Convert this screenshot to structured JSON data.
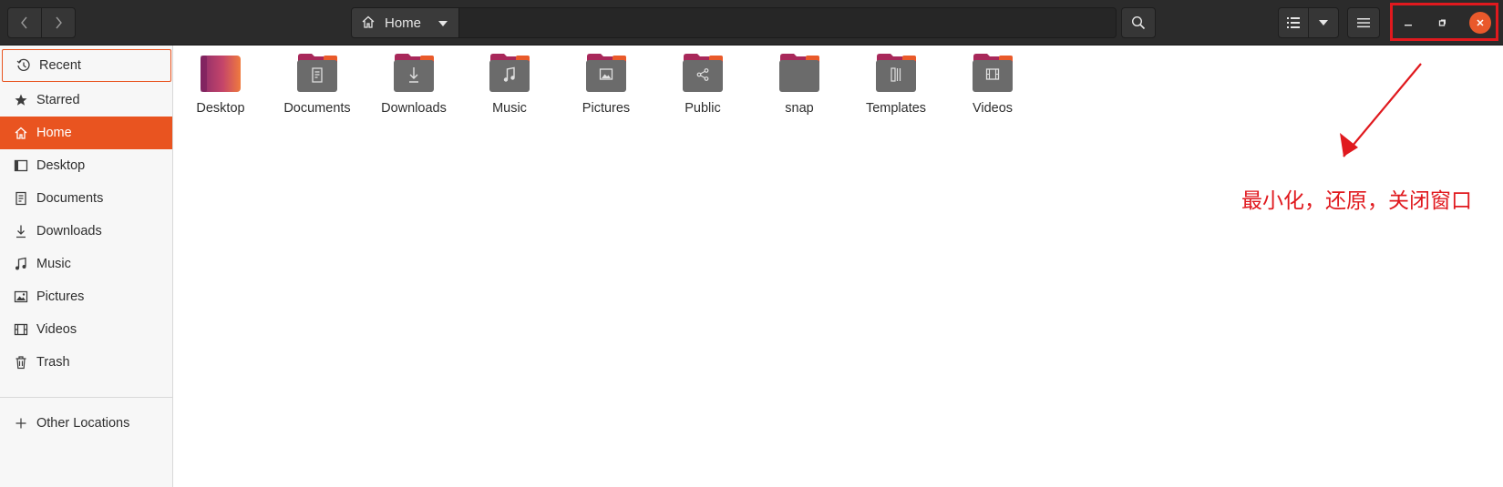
{
  "header": {
    "path_label": "Home",
    "icons": {
      "back": "chevron-left-icon",
      "forward": "chevron-right-icon",
      "home": "home-icon",
      "path_dropdown": "caret-down-icon",
      "search": "search-icon",
      "view_list": "list-view-icon",
      "view_options": "caret-down-icon",
      "menu": "hamburger-menu-icon",
      "minimize": "minimize-icon",
      "restore": "restore-icon",
      "close": "close-icon"
    }
  },
  "sidebar": {
    "items": [
      {
        "label": "Recent",
        "icon": "clock-icon",
        "state": "focused"
      },
      {
        "label": "Starred",
        "icon": "star-icon"
      },
      {
        "label": "Home",
        "icon": "home-icon",
        "state": "active"
      },
      {
        "label": "Desktop",
        "icon": "desktop-icon"
      },
      {
        "label": "Documents",
        "icon": "document-icon"
      },
      {
        "label": "Downloads",
        "icon": "download-icon"
      },
      {
        "label": "Music",
        "icon": "music-icon"
      },
      {
        "label": "Pictures",
        "icon": "picture-icon"
      },
      {
        "label": "Videos",
        "icon": "video-icon"
      },
      {
        "label": "Trash",
        "icon": "trash-icon"
      }
    ],
    "other_locations": {
      "label": "Other Locations",
      "icon": "plus-icon"
    }
  },
  "folders": [
    {
      "label": "Desktop",
      "icon": "desktop-folder-icon"
    },
    {
      "label": "Documents",
      "icon": "documents-folder-icon"
    },
    {
      "label": "Downloads",
      "icon": "downloads-folder-icon"
    },
    {
      "label": "Music",
      "icon": "music-folder-icon"
    },
    {
      "label": "Pictures",
      "icon": "pictures-folder-icon"
    },
    {
      "label": "Public",
      "icon": "public-folder-icon"
    },
    {
      "label": "snap",
      "icon": "folder-icon"
    },
    {
      "label": "Templates",
      "icon": "templates-folder-icon"
    },
    {
      "label": "Videos",
      "icon": "videos-folder-icon"
    }
  ],
  "annotation": {
    "text": "最小化，还原，关闭窗口",
    "color": "#e0191e"
  },
  "colors": {
    "accent": "#e95420",
    "header_bg": "#2b2b2b",
    "sidebar_bg": "#f7f7f7",
    "folder_body": "#6b6b6b",
    "folder_tab": "#a8285a"
  }
}
